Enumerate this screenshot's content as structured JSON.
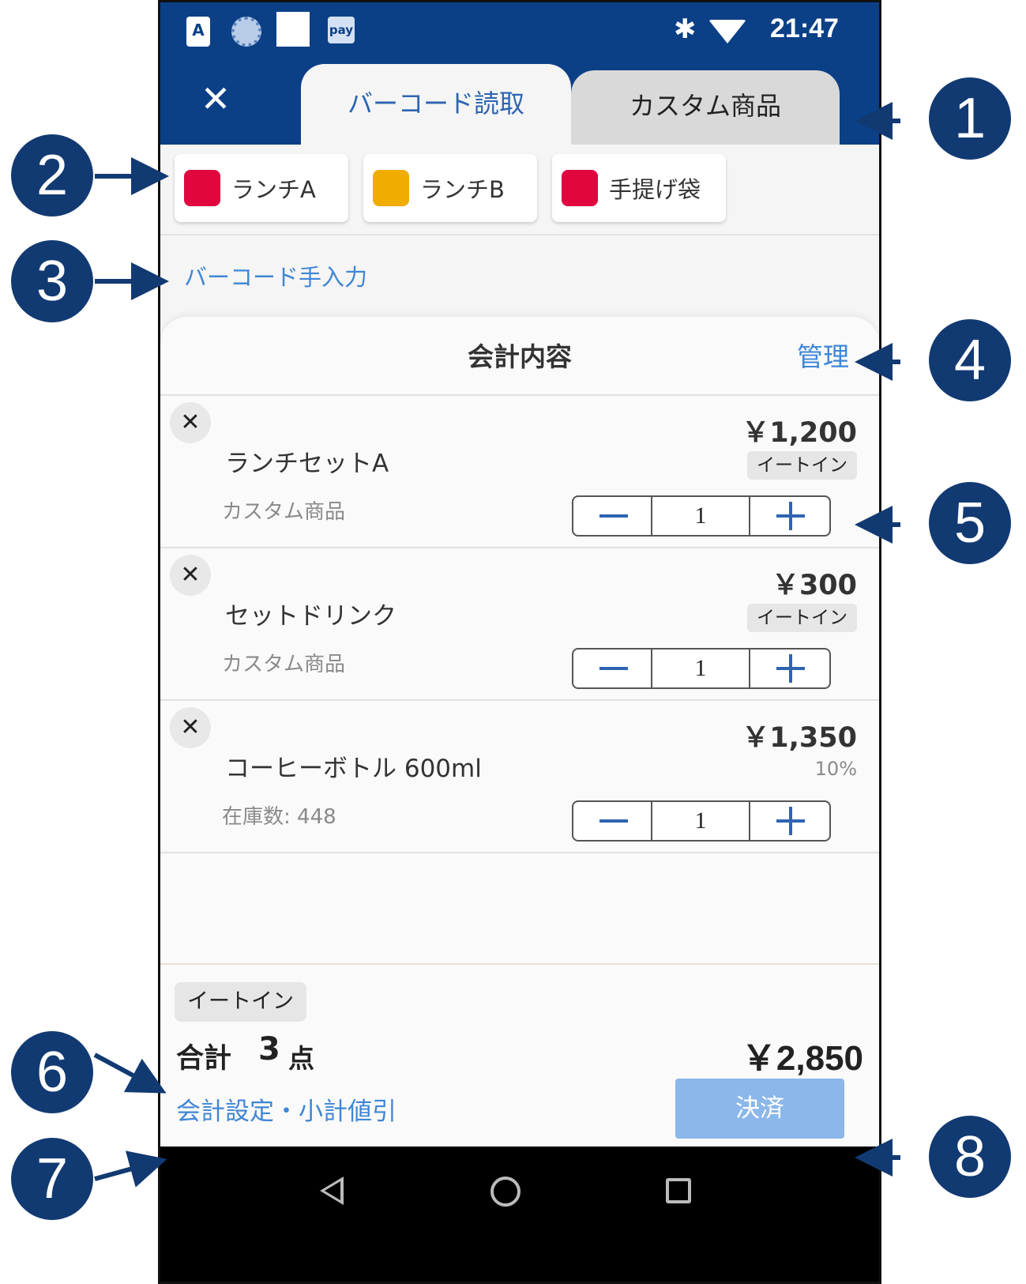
{
  "status_bar": {
    "icon_a": "A",
    "icon_pay": "pay",
    "bluetooth_icon": "bluetooth-icon",
    "wifi_icon": "wifi-icon",
    "time": "21:47"
  },
  "header": {
    "close_icon": "close-icon",
    "tabs": [
      {
        "label": "バーコード読取",
        "active": true
      },
      {
        "label": "カスタム商品",
        "active": false
      }
    ]
  },
  "quick_buttons": [
    {
      "label": "ランチA",
      "color": "#e0063e"
    },
    {
      "label": "ランチB",
      "color": "#f0ad00"
    },
    {
      "label": "手提げ袋",
      "color": "#e0063e"
    }
  ],
  "manual_entry_link": "バーコード手入力",
  "checkout": {
    "title": "会計内容",
    "manage_label": "管理",
    "items": [
      {
        "name": "ランチセットA",
        "sub": "カスタム商品",
        "price": "￥1,200",
        "badge": "イートイン",
        "quantity": "1"
      },
      {
        "name": "セットドリンク",
        "sub": "カスタム商品",
        "price": "￥300",
        "badge": "イートイン",
        "quantity": "1"
      },
      {
        "name": "コーヒーボトル 600ml",
        "sub": "在庫数: 448",
        "price": "￥1,350",
        "tax": "10%",
        "quantity": "1"
      }
    ]
  },
  "footer": {
    "badge": "イートイン",
    "total_label": "合計",
    "total_count": "3",
    "total_unit": "点",
    "total_amount": "￥2,850",
    "settings_link": "会計設定・小計値引",
    "pay_button": "決済"
  },
  "callouts": [
    "1",
    "2",
    "3",
    "4",
    "5",
    "6",
    "7",
    "8"
  ],
  "colors": {
    "brand": "#0b4087",
    "link": "#3f86d6",
    "callout": "#123a72",
    "pay_button": "#8bb7ea"
  }
}
